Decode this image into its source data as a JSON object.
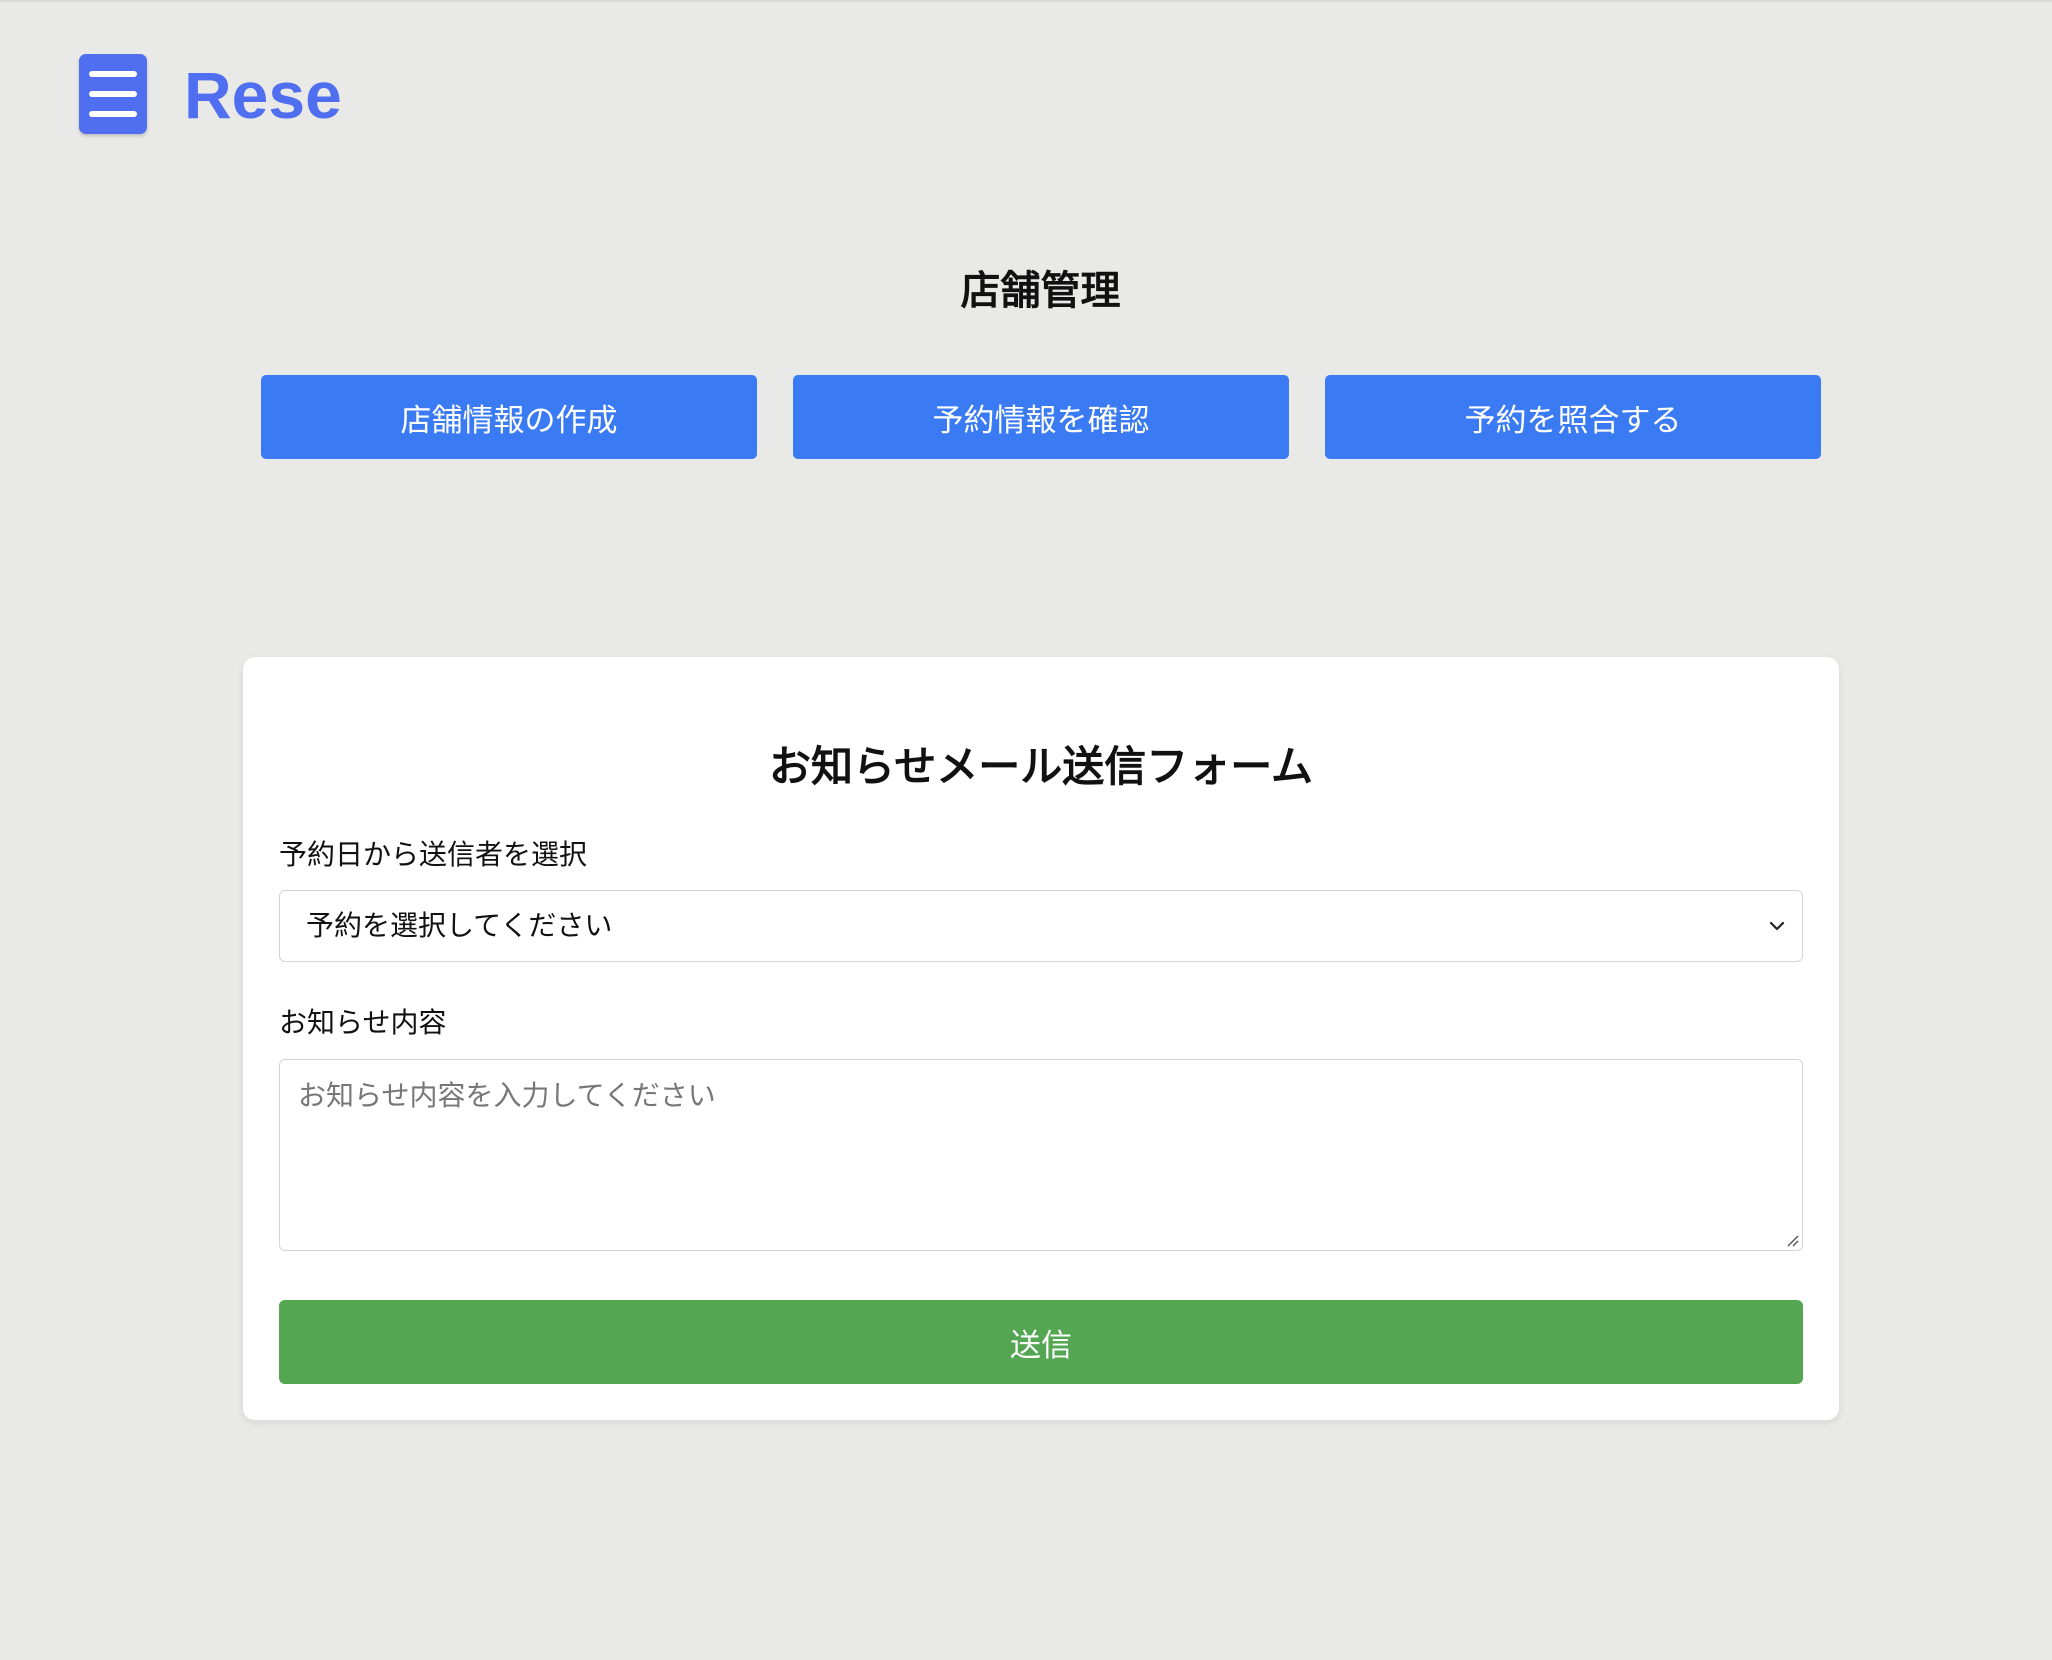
{
  "header": {
    "logo_text": "Rese",
    "menu_icon": "hamburger-icon",
    "accent_color": "#4f6ef0"
  },
  "page": {
    "title": "店舗管理"
  },
  "nav_buttons": [
    {
      "label": "店舗情報の作成"
    },
    {
      "label": "予約情報を確認"
    },
    {
      "label": "予約を照合する"
    }
  ],
  "form": {
    "title": "お知らせメール送信フォーム",
    "reservation_label": "予約日から送信者を選択",
    "reservation_select": {
      "selected_value": "予約を選択してください",
      "icon": "chevron-down-icon"
    },
    "content_label": "お知らせ内容",
    "content_textarea": {
      "value": "",
      "placeholder": "お知らせ内容を入力してください"
    },
    "submit_label": "送信"
  },
  "colors": {
    "background": "#e9e9e8",
    "nav_button": "#3a7af3",
    "submit_button": "#55a653"
  }
}
